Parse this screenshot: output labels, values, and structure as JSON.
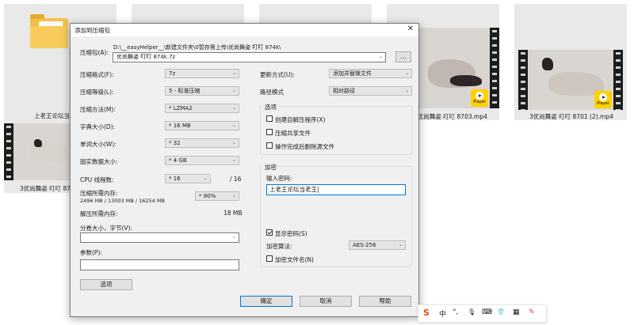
{
  "background_files": [
    {
      "label": "上老王论坛当"
    },
    {
      "label": "3优尚舞姿 叮叮 8703.mp4"
    },
    {
      "label": "3优尚舞姿 叮叮 8701 (2).mp4"
    },
    {
      "label": "3优尚舞姿 叮叮 870"
    }
  ],
  "player_badge": "Player",
  "dialog": {
    "title": "添加到压缩包",
    "close": "✕",
    "archive_label": "压缩包(A):",
    "archive_path": "D:\\__easyHelper__\\新建文件夹\\0暂存需上传\\优尚舞姿 叮叮 874k\\",
    "archive_name": "优尚舞姿 叮叮 874k.7z",
    "browse_label": "...",
    "left": [
      {
        "label": "压缩格式(F):",
        "value": "7z"
      },
      {
        "label": "压缩等级(L):",
        "value": "5 - 标准压缩"
      },
      {
        "label": "压缩方法(M):",
        "value": "* LZMA2"
      },
      {
        "label": "字典大小(D):",
        "value": "* 16 MB"
      },
      {
        "label": "单词大小(W):",
        "value": "* 32"
      },
      {
        "label": "固实数据大小:",
        "value": "* 4 GB"
      }
    ],
    "cpu_label": "CPU 线程数:",
    "cpu_value": "* 16",
    "cpu_max": "/ 16",
    "mem_comp_label": "压缩所需内存:",
    "mem_comp_detail": "2496 MB / 13003 MB / 16254 MB",
    "mem_comp_value": "* 80%",
    "mem_decomp_label": "解压所需内存:",
    "mem_decomp_value": "18 MB",
    "split_label": "分卷大小，字节(V):",
    "split_value": "",
    "params_label": "参数(P):",
    "params_value": "",
    "options_button": "选项",
    "update_label": "更新方式(U):",
    "update_value": "添加并替换文件",
    "path_label": "路径模式",
    "path_value": "相对路径",
    "options_group": "选项",
    "checks": [
      {
        "label": "创建自解压程序(X)",
        "checked": false
      },
      {
        "label": "压缩共享文件",
        "checked": false
      },
      {
        "label": "操作完成后删除源文件",
        "checked": false
      }
    ],
    "encrypt_group": "加密",
    "password_label": "输入密码:",
    "password_value": "上老王论坛当老王|",
    "show_password": {
      "label": "显示密码(S)",
      "checked": true
    },
    "enc_method_label": "加密算法:",
    "enc_method_value": "AES-256",
    "encrypt_names": {
      "label": "加密文件名(N)",
      "checked": false
    },
    "ok": "确定",
    "cancel": "取消",
    "help": "帮助"
  },
  "ime": {
    "logo": "S",
    "lang": "中",
    "punct": "°,",
    "mic": "🎙",
    "keyboard": "⌨",
    "skin": "👕",
    "grid": "▦",
    "tools": "✎"
  }
}
